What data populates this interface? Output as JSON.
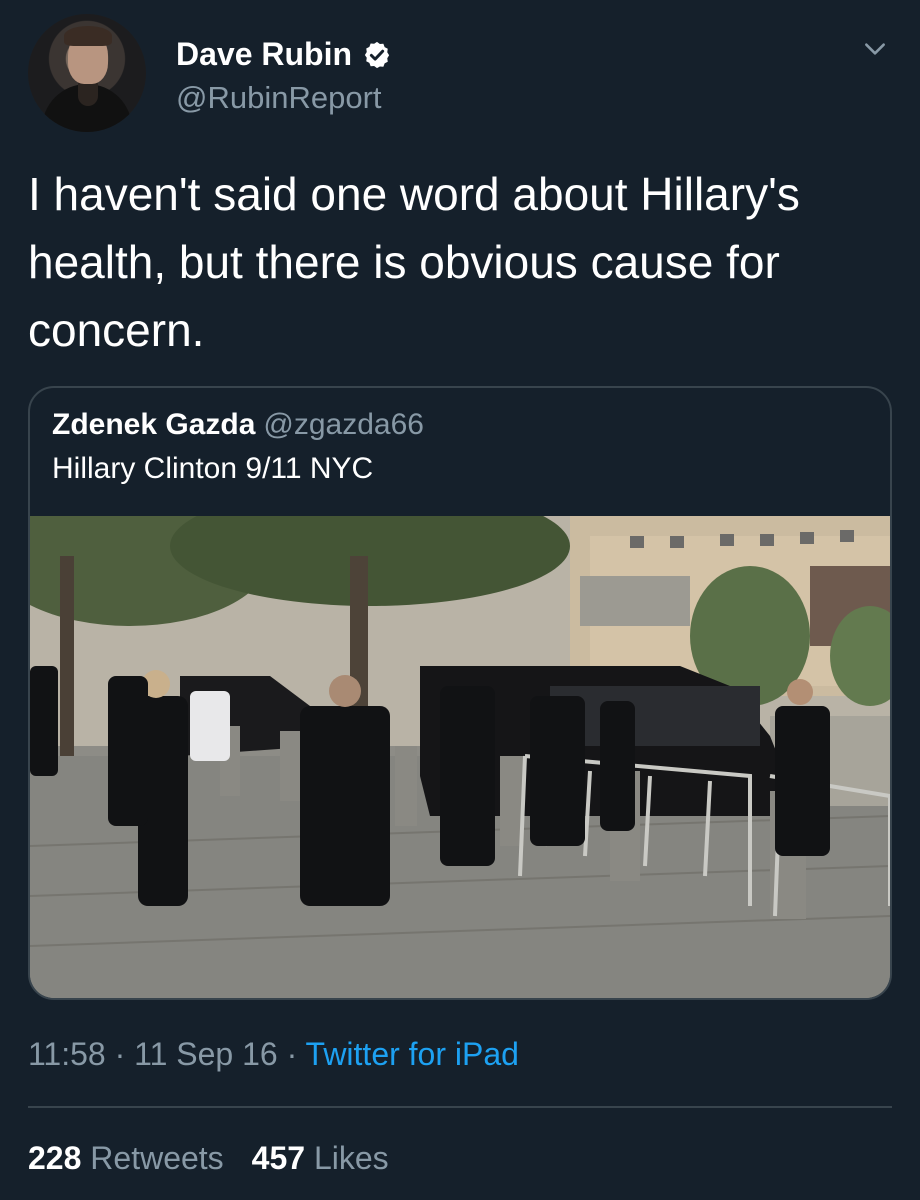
{
  "author": {
    "display_name": "Dave Rubin",
    "handle": "@RubinReport"
  },
  "tweet": {
    "text": "I haven't said one word about Hillary's health, but there is obvious cause for concern."
  },
  "quoted_tweet": {
    "display_name": "Zdenek Gazda",
    "handle": "@zgazda66",
    "text": "Hillary Clinton 9/11 NYC"
  },
  "meta": {
    "time": "11:58",
    "separator": "·",
    "date": "11 Sep 16",
    "source": "Twitter for iPad"
  },
  "stats": {
    "retweets_count": "228",
    "retweets_label": "Retweets",
    "likes_count": "457",
    "likes_label": "Likes"
  },
  "icons": {
    "verified": "verified-badge-icon",
    "menu": "chevron-down-icon"
  },
  "colors": {
    "background": "#15202b",
    "secondary_text": "#8899a6",
    "link": "#1da1f2",
    "border": "#38444d"
  }
}
